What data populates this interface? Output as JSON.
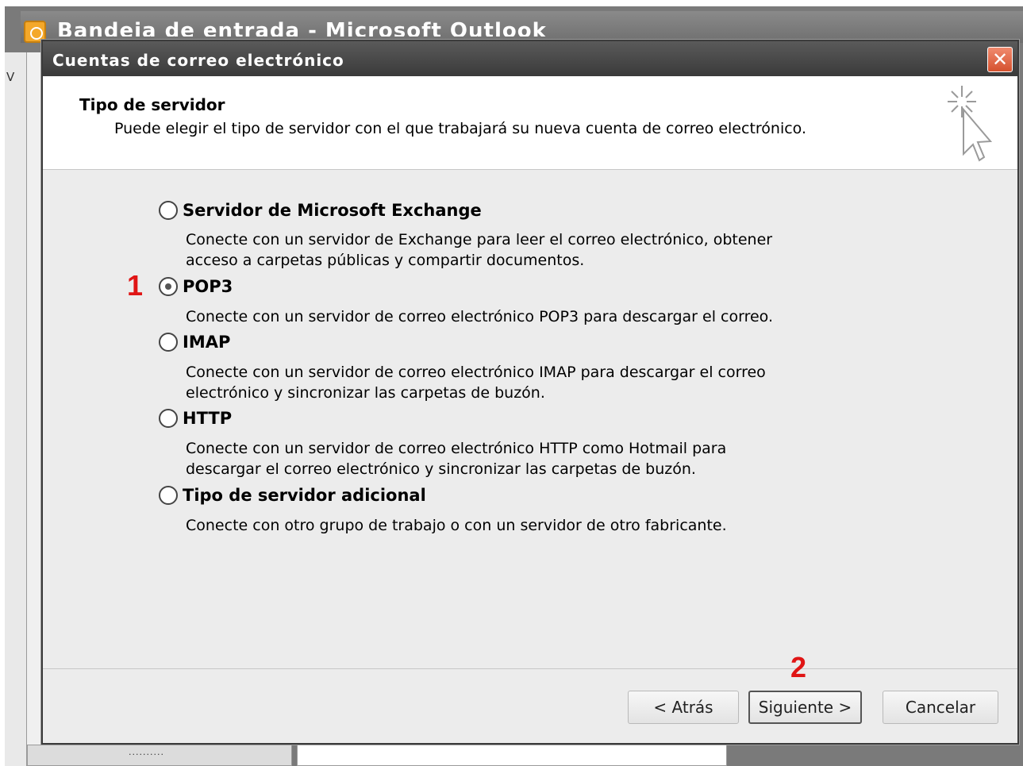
{
  "background_window": {
    "title": "Bandeja de entrada - Microsoft Outlook",
    "left_letter": "V",
    "bottom_dots": "..........",
    "icon": "outlook-clock-icon"
  },
  "dialog": {
    "title": "Cuentas de correo electrónico",
    "close_icon": "close-icon",
    "header": {
      "title": "Tipo de servidor",
      "description": "Puede elegir el tipo de servidor con el que trabajará su nueva cuenta de correo electrónico.",
      "icon": "cursor-sparkle-icon"
    },
    "options": [
      {
        "label": "Servidor de Microsoft Exchange",
        "checked": false,
        "description": [
          "Conecte con un servidor de Exchange para leer el correo electrónico, obtener",
          "acceso a carpetas públicas y compartir documentos."
        ]
      },
      {
        "label": "POP3",
        "checked": true,
        "description": [
          "Conecte con un servidor de correo electrónico POP3 para descargar el correo."
        ]
      },
      {
        "label": "IMAP",
        "checked": false,
        "description": [
          "Conecte con un servidor de correo electrónico IMAP para descargar el correo",
          "electrónico y sincronizar las carpetas de buzón."
        ]
      },
      {
        "label": "HTTP",
        "checked": false,
        "description": [
          "Conecte con un servidor de correo electrónico HTTP como Hotmail para",
          "descargar el correo electrónico y sincronizar las carpetas de buzón."
        ]
      },
      {
        "label": "Tipo de servidor adicional",
        "checked": false,
        "description": [
          "Conecte con otro grupo de trabajo o con un servidor de otro fabricante."
        ]
      }
    ],
    "annotations": {
      "step1": "1",
      "step2": "2"
    },
    "buttons": {
      "back": "< Atrás",
      "next": "Siguiente >",
      "cancel": "Cancelar"
    }
  }
}
